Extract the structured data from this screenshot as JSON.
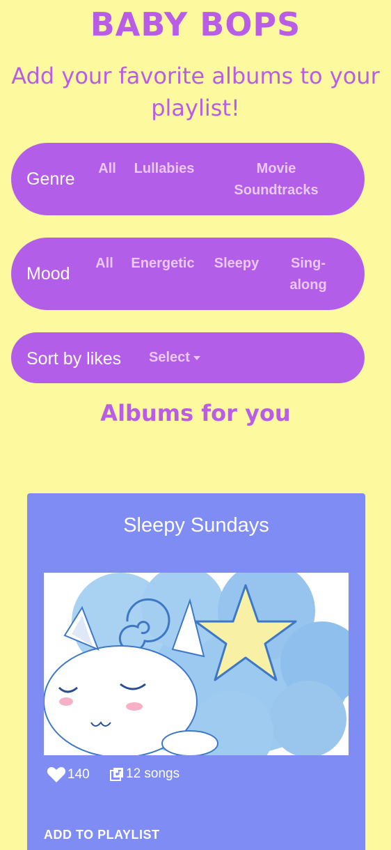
{
  "header": {
    "title": "BABY BOPS",
    "subtitle": "Add your favorite albums to your playlist!"
  },
  "genre": {
    "label": "Genre",
    "options": [
      "All",
      "Lullabies",
      "Movie Soundtracks"
    ]
  },
  "mood": {
    "label": "Mood",
    "options": [
      "All",
      "Energetic",
      "Sleepy",
      "Sing-along"
    ]
  },
  "sort": {
    "label": "Sort by likes",
    "select_value": "Select"
  },
  "section": {
    "title": "Albums for you"
  },
  "album": {
    "title": "Sleepy Sundays",
    "likes": "140",
    "songs": "12 songs",
    "add_label": "ADD TO PLAYLIST"
  },
  "icons": {
    "likes": "heart-icon",
    "songs": "music-library-icon",
    "dropdown": "caret-down-icon"
  },
  "colors": {
    "background": "#fdf99e",
    "accent": "#b95ce6",
    "pill": "#b35ee8",
    "card": "#7f8cf4"
  }
}
